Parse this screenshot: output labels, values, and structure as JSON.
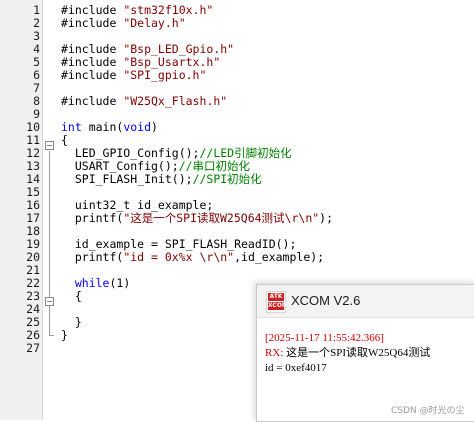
{
  "editor": {
    "lines": [
      {
        "n": "1",
        "parts": [
          {
            "c": "pp",
            "t": "#include "
          },
          {
            "c": "str",
            "t": "\"stm32f10x.h\""
          }
        ]
      },
      {
        "n": "2",
        "parts": [
          {
            "c": "pp",
            "t": "#include "
          },
          {
            "c": "str",
            "t": "\"Delay.h\""
          }
        ]
      },
      {
        "n": "3",
        "parts": []
      },
      {
        "n": "4",
        "parts": [
          {
            "c": "pp",
            "t": "#include "
          },
          {
            "c": "str",
            "t": "\"Bsp_LED_Gpio.h\""
          }
        ]
      },
      {
        "n": "5",
        "parts": [
          {
            "c": "pp",
            "t": "#include "
          },
          {
            "c": "str",
            "t": "\"Bsp_Usartx.h\""
          }
        ]
      },
      {
        "n": "6",
        "parts": [
          {
            "c": "pp",
            "t": "#include "
          },
          {
            "c": "str",
            "t": "\"SPI_gpio.h\""
          }
        ]
      },
      {
        "n": "7",
        "parts": []
      },
      {
        "n": "8",
        "parts": [
          {
            "c": "pp",
            "t": "#include "
          },
          {
            "c": "str",
            "t": "\"W25Qx_Flash.h\""
          }
        ]
      },
      {
        "n": "9",
        "parts": []
      },
      {
        "n": "10",
        "parts": [
          {
            "c": "kw",
            "t": "int"
          },
          {
            "c": "pp",
            "t": " main("
          },
          {
            "c": "kw",
            "t": "void"
          },
          {
            "c": "pp",
            "t": ")"
          }
        ]
      },
      {
        "n": "11",
        "parts": [
          {
            "c": "pp",
            "t": "{"
          }
        ]
      },
      {
        "n": "12",
        "parts": [
          {
            "c": "pp",
            "t": "  LED_GPIO_Config();"
          },
          {
            "c": "cmt",
            "t": "//LED引脚初始化"
          }
        ]
      },
      {
        "n": "13",
        "parts": [
          {
            "c": "pp",
            "t": "  USART_Config();"
          },
          {
            "c": "cmt",
            "t": "//串口初始化"
          }
        ]
      },
      {
        "n": "14",
        "parts": [
          {
            "c": "pp",
            "t": "  SPI_FLASH_Init();"
          },
          {
            "c": "cmt",
            "t": "//SPI初始化"
          }
        ]
      },
      {
        "n": "15",
        "parts": []
      },
      {
        "n": "16",
        "parts": [
          {
            "c": "pp",
            "t": "  uint32_t id_example;"
          }
        ]
      },
      {
        "n": "17",
        "parts": [
          {
            "c": "pp",
            "t": "  printf("
          },
          {
            "c": "str",
            "t": "\"这是一个SPI读取W25Q64测试\\r\\n\""
          },
          {
            "c": "pp",
            "t": ");"
          }
        ]
      },
      {
        "n": "18",
        "parts": []
      },
      {
        "n": "19",
        "parts": [
          {
            "c": "pp",
            "t": "  id_example = SPI_FLASH_ReadID();"
          }
        ]
      },
      {
        "n": "20",
        "parts": [
          {
            "c": "pp",
            "t": "  printf("
          },
          {
            "c": "str",
            "t": "\"id = 0x%x \\r\\n\""
          },
          {
            "c": "pp",
            "t": ",id_example);"
          }
        ]
      },
      {
        "n": "21",
        "parts": []
      },
      {
        "n": "22",
        "parts": [
          {
            "c": "pp",
            "t": "  "
          },
          {
            "c": "kw",
            "t": "while"
          },
          {
            "c": "pp",
            "t": "(1)"
          }
        ]
      },
      {
        "n": "23",
        "parts": [
          {
            "c": "pp",
            "t": "  {"
          }
        ]
      },
      {
        "n": "24",
        "parts": []
      },
      {
        "n": "25",
        "parts": [
          {
            "c": "pp",
            "t": "  }"
          }
        ]
      },
      {
        "n": "26",
        "parts": [
          {
            "c": "pp",
            "t": "}"
          }
        ]
      },
      {
        "n": "27",
        "parts": []
      }
    ]
  },
  "xcom": {
    "logo_top": "ATK",
    "logo_bottom": "XCOM",
    "title": "XCOM V2.6",
    "timestamp": "[2025-11-17 11:55:42.366]",
    "rx_label": "RX:",
    "rx_text": " 这是一个SPI读取W25Q64测试",
    "id_line": "id = 0xef4017"
  },
  "watermark": "CSDN @时光の尘"
}
